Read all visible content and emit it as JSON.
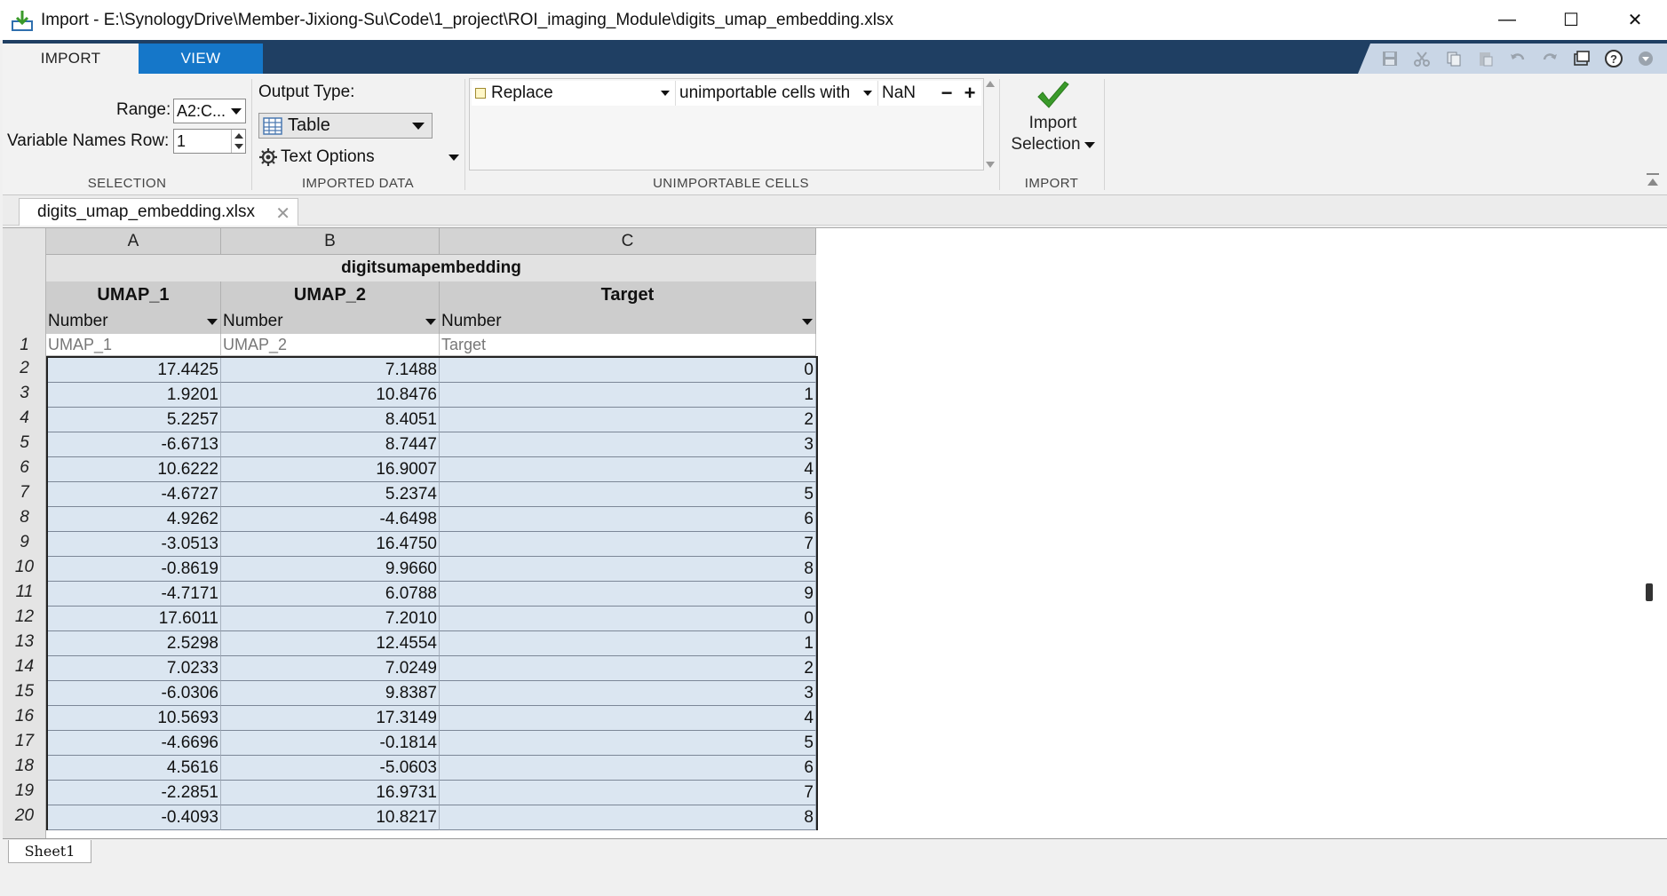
{
  "window": {
    "title": "Import - E:\\SynologyDrive\\Member-Jixiong-Su\\Code\\1_project\\ROI_imaging_Module\\digits_umap_embedding.xlsx",
    "minimize": "—",
    "maximize": "☐",
    "close": "✕"
  },
  "ribbon": {
    "tabs": [
      "IMPORT",
      "VIEW"
    ],
    "selection": {
      "range_label": "Range:",
      "range_value": "A2:C...",
      "varnames_label": "Variable Names Row:",
      "varnames_value": "1",
      "section_label": "SELECTION"
    },
    "imported_data": {
      "output_type_label": "Output Type:",
      "output_type_value": "Table",
      "text_options": "Text Options",
      "section_label": "IMPORTED DATA"
    },
    "unimportable": {
      "action": "Replace",
      "condition": "unimportable cells with",
      "value": "NaN",
      "minus": "−",
      "plus": "+",
      "section_label": "UNIMPORTABLE CELLS"
    },
    "import": {
      "button_line1": "Import",
      "button_line2": "Selection",
      "section_label": "IMPORT"
    }
  },
  "document_tab": "digits_umap_embedding.xlsx",
  "grid": {
    "column_letters": [
      "A",
      "B",
      "C"
    ],
    "table_name": "digitsumapembedding",
    "variable_names": [
      "UMAP_1",
      "UMAP_2",
      "Target"
    ],
    "variable_types": [
      "Number",
      "Number",
      "Number"
    ],
    "header_row_values": [
      "UMAP_1",
      "UMAP_2",
      "Target"
    ],
    "row_numbers": [
      "1",
      "2",
      "3",
      "4",
      "5",
      "6",
      "7",
      "8",
      "9",
      "10",
      "11",
      "12",
      "13",
      "14",
      "15",
      "16",
      "17",
      "18",
      "19",
      "20"
    ],
    "rows": [
      [
        "17.4425",
        "7.1488",
        "0"
      ],
      [
        "1.9201",
        "10.8476",
        "1"
      ],
      [
        "5.2257",
        "8.4051",
        "2"
      ],
      [
        "-6.6713",
        "8.7447",
        "3"
      ],
      [
        "10.6222",
        "16.9007",
        "4"
      ],
      [
        "-4.6727",
        "5.2374",
        "5"
      ],
      [
        "4.9262",
        "-4.6498",
        "6"
      ],
      [
        "-3.0513",
        "16.4750",
        "7"
      ],
      [
        "-0.8619",
        "9.9660",
        "8"
      ],
      [
        "-4.7171",
        "6.0788",
        "9"
      ],
      [
        "17.6011",
        "7.2010",
        "0"
      ],
      [
        "2.5298",
        "12.4554",
        "1"
      ],
      [
        "7.0233",
        "7.0249",
        "2"
      ],
      [
        "-6.0306",
        "9.8387",
        "3"
      ],
      [
        "10.5693",
        "17.3149",
        "4"
      ],
      [
        "-4.6696",
        "-0.1814",
        "5"
      ],
      [
        "4.5616",
        "-5.0603",
        "6"
      ],
      [
        "-2.2851",
        "16.9731",
        "7"
      ],
      [
        "-0.4093",
        "10.8217",
        "8"
      ]
    ]
  },
  "sheet_tab": "Sheet1",
  "colors": {
    "tabstrip": "#1f3f63",
    "active_view_tab": "#1577c9",
    "selection_fill": "#dbe6f1",
    "header_fill": "#cdcdcd",
    "check_green": "#3a9a2a"
  },
  "icons": [
    "import-app-icon",
    "save-icon",
    "cut-icon",
    "copy-icon",
    "paste-icon",
    "undo-icon",
    "redo-icon",
    "window-icon",
    "help-icon",
    "dropdown-icon",
    "table-icon",
    "gear-icon",
    "checkmark-icon",
    "close-icon"
  ]
}
